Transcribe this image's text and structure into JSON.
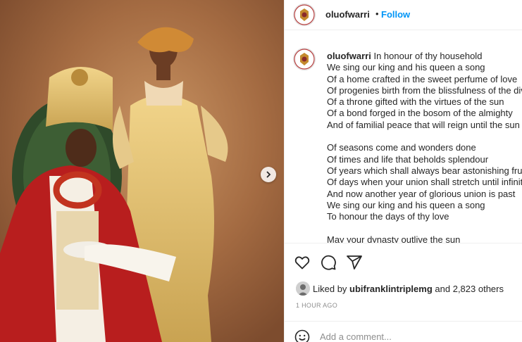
{
  "post": {
    "username": "oluofwarri",
    "follow_label": "Follow",
    "separator": "•",
    "caption_lines": [
      "In honour of thy household",
      "We sing our king and his queen a song",
      "Of a home crafted in the sweet perfume of love",
      "Of progenies birth from the blissfulness of the div",
      "Of a throne gifted with the virtues of the sun",
      "Of a bond forged in the bosom of the almighty",
      "And of familial peace that will reign until the sun i",
      "",
      "Of seasons come and wonders done",
      "Of times and life that beholds splendour",
      "Of years which shall always bear astonishing fruits",
      "Of days when your union shall stretch until infinity",
      "And now another year of glorious union is past",
      "We sing our king and his queen a song",
      "To honour the days of thy love",
      "",
      "May your dynasty outlive the sun"
    ],
    "likes": {
      "prefix": "Liked by",
      "user": "ubifranklintriplemg",
      "suffix": "and 2,823 others"
    },
    "timestamp": "1 HOUR AGO",
    "comment_placeholder": "Add a comment..."
  },
  "icons": {
    "like": "heart-icon",
    "comment": "comment-icon",
    "share": "paper-plane-icon",
    "emoji": "smiley-icon",
    "next": "chevron-right-icon"
  },
  "colors": {
    "follow": "#0095f6",
    "text": "#262626",
    "muted": "#8e8e8e"
  }
}
